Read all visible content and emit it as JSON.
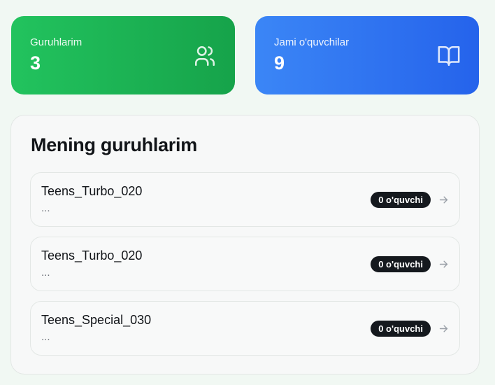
{
  "stats": {
    "groups": {
      "label": "Guruhlarim",
      "value": "3",
      "icon": "users-icon"
    },
    "students": {
      "label": "Jami o'quvchilar",
      "value": "9",
      "icon": "book-open-icon"
    }
  },
  "groups_panel": {
    "title": "Mening guruhlarim",
    "items": [
      {
        "name": "Teens_Turbo_020",
        "subtitle": "...",
        "badge": "0 o'quvchi"
      },
      {
        "name": "Teens_Turbo_020",
        "subtitle": "...",
        "badge": "0 o'quvchi"
      },
      {
        "name": "Teens_Special_030",
        "subtitle": "...",
        "badge": "0 o'quvchi"
      }
    ]
  },
  "colors": {
    "green_start": "#22c35e",
    "green_end": "#16a34a",
    "blue_start": "#3b86f6",
    "blue_end": "#2563eb",
    "badge_bg": "#15191e",
    "page_bg": "#f1f8f3"
  }
}
